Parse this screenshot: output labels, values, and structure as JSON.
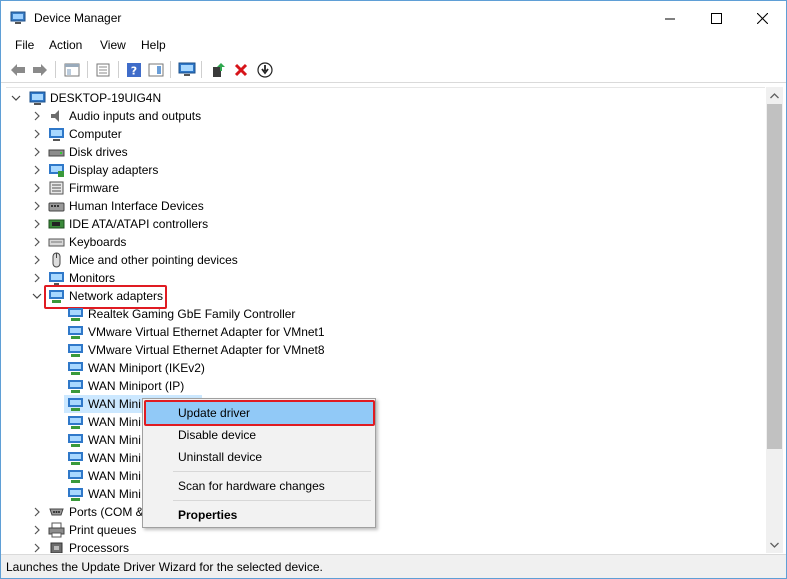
{
  "window": {
    "title": "Device Manager",
    "app_icon": "device-manager-icon",
    "controls": {
      "minimize": "—",
      "maximize": "☐",
      "close": "✕"
    }
  },
  "menu": [
    "File",
    "Action",
    "View",
    "Help"
  ],
  "toolbar": {
    "buttons": [
      "back-icon",
      "forward-icon",
      "show-hide-console-tree-icon",
      "properties-icon",
      "help-icon",
      "action-pane-icon",
      "scan-for-changes-icon",
      "update-driver-icon",
      "uninstall-icon",
      "disable-device-icon"
    ]
  },
  "tree": {
    "root": "DESKTOP-19UIG4N",
    "categories": [
      {
        "label": "Audio inputs and outputs",
        "icon": "speaker-icon"
      },
      {
        "label": "Computer",
        "icon": "computer-icon"
      },
      {
        "label": "Disk drives",
        "icon": "disk-drive-icon"
      },
      {
        "label": "Display adapters",
        "icon": "display-adapter-icon"
      },
      {
        "label": "Firmware",
        "icon": "firmware-icon"
      },
      {
        "label": "Human Interface Devices",
        "icon": "hid-icon"
      },
      {
        "label": "IDE ATA/ATAPI controllers",
        "icon": "ide-controller-icon"
      },
      {
        "label": "Keyboards",
        "icon": "keyboard-icon"
      },
      {
        "label": "Mice and other pointing devices",
        "icon": "mouse-icon"
      },
      {
        "label": "Monitors",
        "icon": "monitor-icon"
      },
      {
        "label": "Network adapters",
        "icon": "network-adapter-icon",
        "expanded": true
      }
    ],
    "network_children": [
      "Realtek Gaming GbE Family Controller",
      "VMware Virtual Ethernet Adapter for VMnet1",
      "VMware Virtual Ethernet Adapter for VMnet8",
      "WAN Miniport (IKEv2)",
      "WAN Miniport (IP)",
      "WAN Mini",
      "WAN Mini",
      "WAN Mini",
      "WAN Mini",
      "WAN Mini",
      "WAN Mini"
    ],
    "after": [
      {
        "label": "Ports (COM &",
        "icon": "port-icon"
      },
      {
        "label": "Print queues",
        "icon": "printer-icon"
      },
      {
        "label": "Processors",
        "icon": "processor-icon"
      }
    ]
  },
  "context_menu": {
    "update_driver": "Update driver",
    "disable_device": "Disable device",
    "uninstall_device": "Uninstall device",
    "scan_hardware": "Scan for hardware changes",
    "properties": "Properties"
  },
  "status": "Launches the Update Driver Wizard for the selected device.",
  "colors": {
    "highlight": "#91c9f7",
    "selection": "#cce8ff",
    "annotation_red": "#e01b22",
    "window_border": "#5f9fd6"
  }
}
